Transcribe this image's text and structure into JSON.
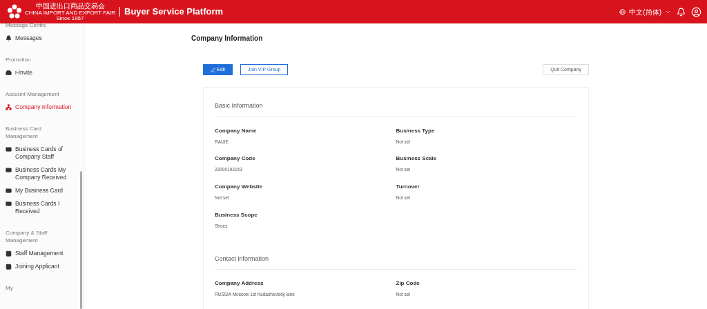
{
  "header": {
    "logo_cn": "中国进出口商品交易会",
    "logo_en": "CHINA IMPORT AND EXPORT FAIR",
    "logo_since": "Since 1957",
    "title": "Buyer Service Platform",
    "language": "中文(简体)"
  },
  "sidebar": {
    "sections": [
      {
        "title": "Message Centre",
        "items": [
          {
            "label": "Messages",
            "selected": false
          }
        ]
      },
      {
        "title": "Promotion",
        "items": [
          {
            "label": "i-Invite",
            "selected": false
          }
        ]
      },
      {
        "title": "Account Management",
        "items": [
          {
            "label": "Company Information",
            "selected": true
          }
        ]
      },
      {
        "title": "Business Card Management",
        "items": [
          {
            "label": "Business Cards of Company Staff",
            "selected": false
          },
          {
            "label": "Business Cards My Company Received",
            "selected": false
          },
          {
            "label": "My Business Card",
            "selected": false
          },
          {
            "label": "Business Cards I Received",
            "selected": false
          }
        ]
      },
      {
        "title": "Company & Staff Management",
        "items": [
          {
            "label": "Staff Management",
            "selected": false
          },
          {
            "label": "Joining Applicant",
            "selected": false
          }
        ]
      },
      {
        "title": "My"
      }
    ]
  },
  "page": {
    "title": "Company Information",
    "buttons": [
      {
        "label": "Edit",
        "kind": "primary"
      },
      {
        "label": "Join VIP Group",
        "kind": "outline"
      },
      {
        "label": "Quit Company",
        "kind": "plain"
      }
    ],
    "sections": [
      {
        "title": "Basic Information",
        "fields": [
          {
            "label": "Company Name",
            "value": "RAUIE"
          },
          {
            "label": "Business Type",
            "value": "Not set"
          },
          {
            "label": "Company Code",
            "value": "23000193153"
          },
          {
            "label": "Business Scale",
            "value": "Not set"
          },
          {
            "label": "Company Website",
            "value": "Not set"
          },
          {
            "label": "Turnover",
            "value": "Not set"
          },
          {
            "label": "Business Scope",
            "value": "Shoes"
          }
        ]
      },
      {
        "title": "Contact information",
        "fields": [
          {
            "label": "Company Address",
            "value": "RUSSIA Moscow 1st Kadashevskiy lane"
          },
          {
            "label": "Zip Code",
            "value": "Not set"
          }
        ]
      }
    ]
  }
}
